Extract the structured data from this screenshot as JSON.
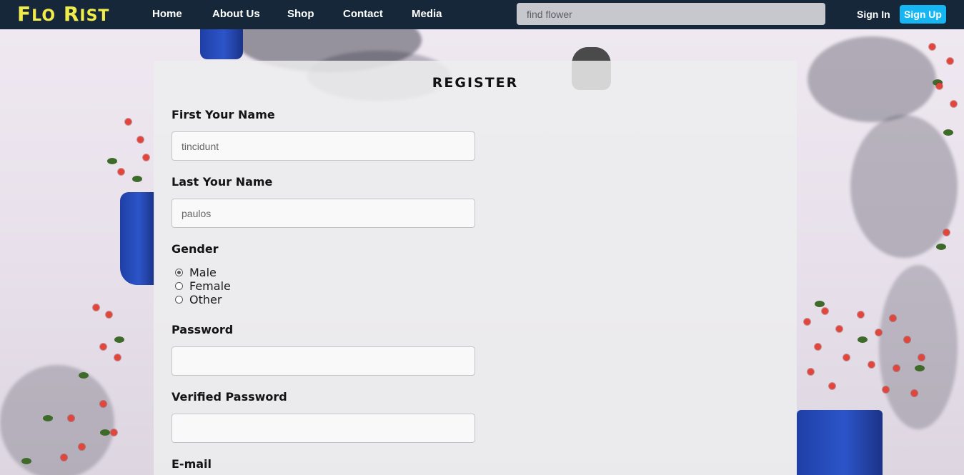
{
  "brand": {
    "text_first": "F",
    "text_first_rest": "LO",
    "text_second": "R",
    "text_second_rest": "IST",
    "color": "#f0ec4a"
  },
  "nav": {
    "items": [
      {
        "label": "Home"
      },
      {
        "label": "About Us"
      },
      {
        "label": "Shop"
      },
      {
        "label": "Contact"
      },
      {
        "label": "Media"
      }
    ],
    "search_placeholder": "find flower",
    "signin_label": "Sign In",
    "signup_label": "Sign Up",
    "bar_color": "#16273a",
    "signup_color": "#15b6f2"
  },
  "form": {
    "title": "REGISTER",
    "first_name": {
      "label": "First Your Name",
      "value": "tincidunt"
    },
    "last_name": {
      "label": "Last Your Name",
      "value": "paulos"
    },
    "gender": {
      "label": "Gender",
      "options": [
        {
          "label": "Male",
          "checked": true
        },
        {
          "label": "Female",
          "checked": false
        },
        {
          "label": "Other",
          "checked": false
        }
      ]
    },
    "password": {
      "label": "Password",
      "value": ""
    },
    "verified_password": {
      "label": "Verified Password",
      "value": ""
    },
    "email": {
      "label": "E-mail"
    }
  }
}
